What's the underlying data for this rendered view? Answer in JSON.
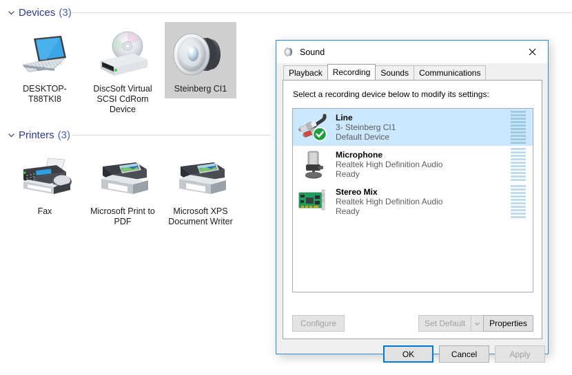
{
  "explorer": {
    "groups": [
      {
        "chevron_icon": "chevron-down-icon",
        "title": "Devices",
        "count": "(3)"
      },
      {
        "chevron_icon": "chevron-down-icon",
        "title": "Printers",
        "count": "(3)"
      }
    ],
    "devices": [
      {
        "label": "DESKTOP-T88TKI8",
        "icon": "laptop-computer-icon",
        "selected": false
      },
      {
        "label": "DiscSoft Virtual SCSI CdRom Device",
        "icon": "cd-rom-drive-icon",
        "selected": false
      },
      {
        "label": "Steinberg CI1",
        "icon": "speaker-audio-device-icon",
        "selected": true
      }
    ],
    "printers": [
      {
        "label": "Fax",
        "icon": "fax-machine-icon"
      },
      {
        "label": "Microsoft Print to PDF",
        "icon": "printer-icon"
      },
      {
        "label": "Microsoft XPS Document Writer",
        "icon": "printer-icon"
      }
    ]
  },
  "dialog": {
    "title": "Sound",
    "title_icon": "speaker-icon",
    "close_icon": "close-icon",
    "tabs": [
      {
        "label": "Playback",
        "active": false
      },
      {
        "label": "Recording",
        "active": true
      },
      {
        "label": "Sounds",
        "active": false
      },
      {
        "label": "Communications",
        "active": false
      }
    ],
    "panel_caption": "Select a recording device below to modify its settings:",
    "recording_devices": [
      {
        "name": "Line",
        "description": "3- Steinberg CI1",
        "status": "Default Device",
        "icon": "rca-line-in-icon",
        "badge_icon": "green-check-default-icon",
        "selected": true,
        "meter_segments": 10
      },
      {
        "name": "Microphone",
        "description": "Realtek High Definition Audio",
        "status": "Ready",
        "icon": "microphone-icon",
        "badge_icon": "",
        "selected": false,
        "meter_segments": 10
      },
      {
        "name": "Stereo Mix",
        "description": "Realtek High Definition Audio",
        "status": "Ready",
        "icon": "sound-card-icon",
        "badge_icon": "",
        "selected": false,
        "meter_segments": 10
      }
    ],
    "panel_buttons": {
      "configure": "Configure",
      "set_default": "Set Default",
      "set_default_arrow_icon": "chevron-down-icon",
      "properties": "Properties"
    },
    "dialog_buttons": {
      "ok": "OK",
      "cancel": "Cancel",
      "apply": "Apply"
    }
  },
  "colors": {
    "accent": "#0078d7",
    "selection": "#cce8ff",
    "group_title": "#2b3a8f",
    "tile_selected": "#cfcfcf",
    "meter": "#bfdcee"
  }
}
